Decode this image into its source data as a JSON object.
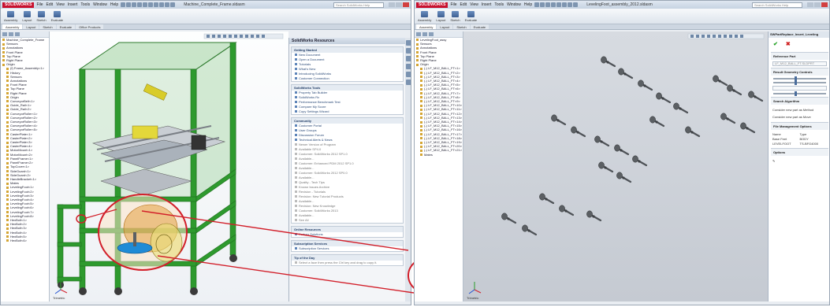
{
  "left_window": {
    "app_logo": "SOLIDWORKS",
    "menu": [
      "File",
      "Edit",
      "View",
      "Insert",
      "Tools",
      "Window",
      "Help"
    ],
    "doc_title": "Machine_Complete_Frame.sldasm",
    "search_placeholder": "Search SolidWorks Help",
    "ribbon": [
      "Assembly",
      "Layout",
      "Sketch",
      "Evaluate",
      "Office Products"
    ],
    "tabs": [
      "Assembly",
      "Layout",
      "Sketch",
      "Evaluate",
      "Office Products"
    ],
    "tree_items": [
      "Machine_Complete_Frame",
      "Sensors",
      "Annotations",
      "Front Plane",
      "Top Plane",
      "Right Plane",
      "Origin",
      "(f) Frame_Assembly<1>",
      "History",
      "Sensors",
      "Annotations",
      "Front Plane",
      "Top Plane",
      "Right Plane",
      "Origin",
      "ConveyorBelt<1>",
      "Guide_Rail<1>",
      "Guide_Rail<2>",
      "ConveyorRoller<1>",
      "ConveyorRoller<2>",
      "ConveyorRoller<3>",
      "ConveyorRoller<4>",
      "ConveyorRoller<5>",
      "CasterPlate<1>",
      "CasterPlate<2>",
      "CasterPlate<3>",
      "CasterPlate<4>",
      "MotorMount<1>",
      "MotorMount<2>",
      "PanelFrame<1>",
      "PanelFrame<2>",
      "TopCover<1>",
      "SideGuard<1>",
      "SideGuard<2>",
      "HandleBracket<1>",
      "Mates",
      "LevelingFoot<1>",
      "LevelingFoot<2>",
      "LevelingFoot<3>",
      "LevelingFoot<4>",
      "LevelingFoot<5>",
      "LevelingFoot<6>",
      "LevelingFoot<7>",
      "LevelingFoot<8>",
      "HexBolt<1>",
      "HexBolt<2>",
      "HexBolt<3>",
      "HexBolt<4>",
      "HexBolt<5>",
      "HexBolt<6>"
    ],
    "triad_label": "Trimetric"
  },
  "task_pane": {
    "title": "SolidWorks Resources",
    "sections": [
      {
        "title": "Getting Started",
        "items": [
          "New Document",
          "Open a Document",
          "Tutorials",
          "What's New",
          "Introducing SolidWorks",
          "Customer Connection"
        ]
      },
      {
        "title": "SolidWorks Tools",
        "items": [
          "Property Tab Builder",
          "SolidWorks Rx",
          "Performance Benchmark Test",
          "Compare My Score",
          "Copy Settings Wizard"
        ]
      },
      {
        "title": "Community",
        "items": [
          "Customer Portal",
          "User Groups",
          "Discussion Forum",
          "Technical Alerts & News"
        ]
      },
      {
        "title": "Online Resources",
        "items": [
          "Partner Solutions"
        ]
      },
      {
        "title": "Subscription Services",
        "items": [
          "Subscription Services"
        ]
      }
    ],
    "news_items": [
      "Newer Version of Program",
      "Available SP4.0",
      "Customer: SolidWorks 2012 SP1.0",
      "Available...",
      "Customer: Enhanced PDM 2012 SP1.0",
      "Available...",
      "Customer: SolidWorks 2012 SP0.0",
      "Available...",
      "Quality - Tech Tips",
      "Known Issues Archive",
      "Revision - Tutorials",
      "Revision: New Tutorial Products",
      "Available...",
      "Revision: New Knowledge",
      "Customer: SolidWorks 2013",
      "Available..."
    ],
    "see_all": "See All",
    "tip_title": "Tip of the Day",
    "tip_text": "Select a face then press the Ctrl key and drag to copy it."
  },
  "right_window": {
    "doc_title": "LevelingFoot_assembly_2012.sldasm",
    "tree_items": [
      "LevelingFoot_assy",
      "Sensors",
      "Annotations",
      "Front Plane",
      "Top Plane",
      "Right Plane",
      "Origin",
      "(-) LF_M12_BALL_FT<1>",
      "(-) LF_M12_BALL_FT<2>",
      "(-) LF_M12_BALL_FT<3>",
      "(-) LF_M12_BALL_FT<4>",
      "(-) LF_M12_BALL_FT<5>",
      "(-) LF_M12_BALL_FT<6>",
      "(-) LF_M12_BALL_FT<7>",
      "(-) LF_M12_BALL_FT<8>",
      "(-) LF_M12_BALL_FT<9>",
      "(-) LF_M12_BALL_FT<10>",
      "(-) LF_M12_BALL_FT<11>",
      "(-) LF_M12_BALL_FT<12>",
      "(-) LF_M12_BALL_FT<13>",
      "(-) LF_M12_BALL_FT<14>",
      "(-) LF_M12_BALL_FT<15>",
      "(-) LF_M12_BALL_FT<16>",
      "(-) LF_M12_BALL_FT<17>",
      "(-) LF_M12_BALL_FT<18>",
      "(-) LF_M12_BALL_FT<19>",
      "(-) LF_M12_BALL_FT<20>",
      "(-) LF_M12_BALL_FT<21>",
      "Mates"
    ],
    "triad_label": "Trimetric"
  },
  "property_manager": {
    "title": "SWPartReplace_Insert_Leveling",
    "section1": "Reference Part",
    "ref_value": "LF_M12_BALL_FT.SLDPRT",
    "section2": "Result Geometry Controls",
    "section3": "Search Algorithm",
    "opt1": "Consider new part as Method",
    "opt2": "Consider new part as Move",
    "section4": "File Management Options",
    "grid": [
      "Name",
      "Type",
      "Base Feet",
      "BODY",
      "LEVELFOOT",
      "TS-BFG4000"
    ],
    "section5": "Options"
  },
  "colors": {
    "frame_green": "#2e9a2e",
    "glass": "#9fd29f",
    "callout_red": "#d21f2a",
    "highlight_blue": "#1640a8",
    "foot_gray": "#5b5f63"
  }
}
